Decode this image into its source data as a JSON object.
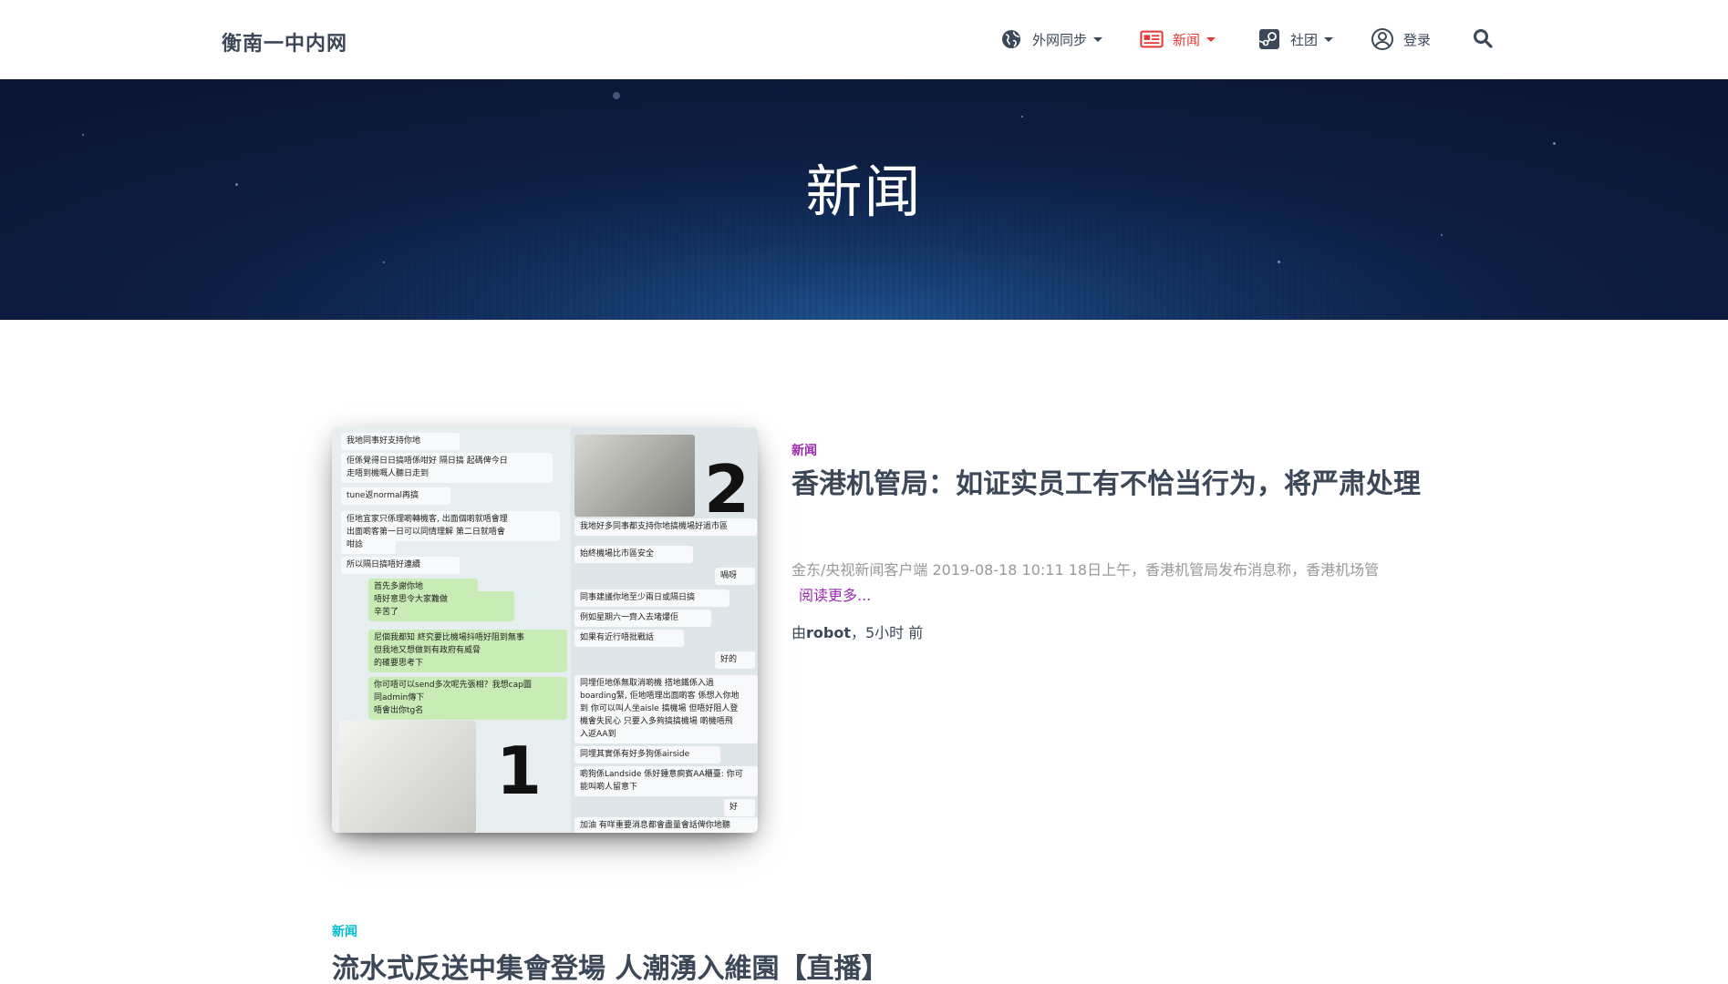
{
  "header": {
    "brand": "衡南一中内网",
    "nav": {
      "sync_label": "外网同步",
      "news_label": "新闻",
      "club_label": "社团",
      "login_label": "登录"
    },
    "icons": {
      "sync": "globe-icon",
      "news": "newspaper-icon",
      "club": "steam-icon",
      "login": "user-circle-icon",
      "search": "search-icon"
    },
    "active_color": "#e53935"
  },
  "hero": {
    "title": "新闻"
  },
  "articles": [
    {
      "category": "新闻",
      "title": "香港机管局：如证实员工有不恰当行为，将严肃处理",
      "excerpt": "金东/央视新闻客户端 2019-08-18 10:11 18日上午，香港机管局发布消息称，香港机场管",
      "read_more": "阅读更多...",
      "byline_prefix": "由",
      "author": "robot",
      "time": "，5小时 前",
      "thumbnail": {
        "left_bubbles": [
          "我地同事好支持你地",
          "佢係覺得日日搞唔係咁好 隔日搞 起碼俾今日",
          "走唔到機嘅人聽日走到",
          "tune返normal再搞",
          "佢地宜家只係理啲轉機客, 出面個啲就唔會理",
          "出面啲客第一日可以同情理解 第二日就唔會",
          "咁諗",
          "所以隔日搞唔好連續"
        ],
        "left_green": [
          "首先多謝你地",
          "唔好意思令大家難做",
          "辛苦了",
          "尼個我都知 終究要比機場抖唔好阻到無事",
          "但我地又想做到有政府有威脅",
          "的確要思考下",
          "你可唔可以send多次呢先張相？我想cap圖",
          "同admin傳下",
          "唔會出你tg名"
        ],
        "right_bubbles": [
          "我地好多同事都支持你地搞機場好過市區",
          "始終機場比市區安全",
          "同事建議你地至少兩日或隔日搞",
          "例如星期六一齊入去堵爆佢",
          "如果有近行唔批戰話",
          "同埋佢地係無取消啲機 搭地鐵係入過",
          "boarding緊, 佢地唔理出面啲客 係想入你地",
          "到 你可以叫人坐aisle 搞機場 但唔好阻人登",
          "機會失民心 只要入多夠搞搞機場 啲機唔飛",
          "入返AA到",
          "同埋其實係有好多狗係airside",
          "啲狗係Landside 係好鍾意痾賓AA櫃臺: 你可",
          "能叫啲人留意下",
          "加油 有咩重要消息都會盡量會話俾你地聽"
        ],
        "right_short": [
          "喎呀",
          "好的",
          "好"
        ],
        "numbers": [
          "1",
          "2"
        ]
      }
    },
    {
      "category": "新闻",
      "title": "流水式反送中集會登場 人潮湧入維園【直播】"
    }
  ]
}
